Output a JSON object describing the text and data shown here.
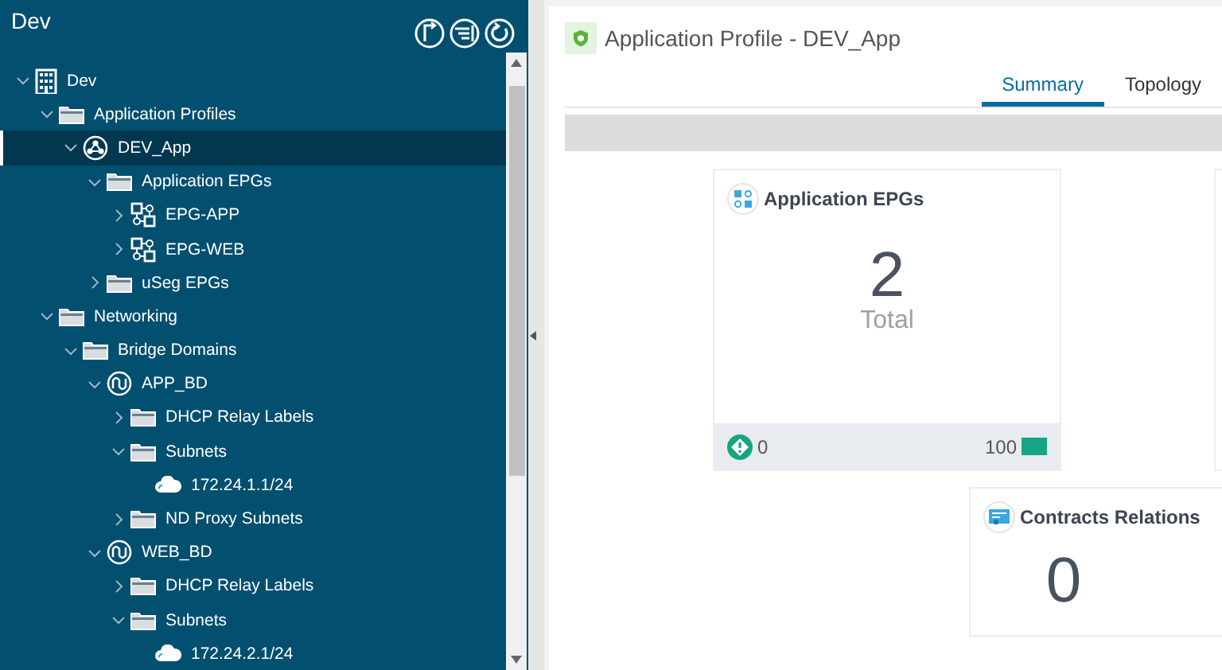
{
  "sidebar": {
    "title": "Dev",
    "toolbar": [
      {
        "kind": "flag"
      },
      {
        "kind": "filter"
      },
      {
        "kind": "refresh"
      }
    ],
    "tree": [
      {
        "label": "Dev",
        "kind": "tenant",
        "expanded": true,
        "selected": false,
        "children": [
          {
            "label": "Application Profiles",
            "kind": "folder",
            "expanded": true,
            "selected": false,
            "children": [
              {
                "label": "DEV_App",
                "kind": "app",
                "expanded": true,
                "selected": true,
                "children": [
                  {
                    "label": "Application EPGs",
                    "kind": "folder",
                    "expanded": true,
                    "selected": false,
                    "children": [
                      {
                        "label": "EPG-APP",
                        "kind": "epg",
                        "expanded": false,
                        "selected": false
                      },
                      {
                        "label": "EPG-WEB",
                        "kind": "epg",
                        "expanded": false,
                        "selected": false
                      }
                    ]
                  },
                  {
                    "label": "uSeg EPGs",
                    "kind": "folder",
                    "expanded": false,
                    "selected": false
                  }
                ]
              }
            ]
          },
          {
            "label": "Networking",
            "kind": "folder",
            "expanded": true,
            "selected": false,
            "children": [
              {
                "label": "Bridge Domains",
                "kind": "folder",
                "expanded": true,
                "selected": false,
                "children": [
                  {
                    "label": "APP_BD",
                    "kind": "bd",
                    "expanded": true,
                    "selected": false,
                    "children": [
                      {
                        "label": "DHCP Relay Labels",
                        "kind": "folder",
                        "expanded": false,
                        "selected": false
                      },
                      {
                        "label": "Subnets",
                        "kind": "folder",
                        "expanded": true,
                        "selected": false,
                        "children": [
                          {
                            "label": "172.24.1.1/24",
                            "kind": "cloud",
                            "selected": false
                          }
                        ]
                      },
                      {
                        "label": "ND Proxy Subnets",
                        "kind": "folder",
                        "expanded": false,
                        "selected": false
                      }
                    ]
                  },
                  {
                    "label": "WEB_BD",
                    "kind": "bd",
                    "expanded": true,
                    "selected": false,
                    "children": [
                      {
                        "label": "DHCP Relay Labels",
                        "kind": "folder",
                        "expanded": false,
                        "selected": false
                      },
                      {
                        "label": "Subnets",
                        "kind": "folder",
                        "expanded": true,
                        "selected": false,
                        "children": [
                          {
                            "label": "172.24.2.1/24",
                            "kind": "cloud",
                            "selected": false
                          }
                        ]
                      }
                    ]
                  }
                ]
              }
            ]
          }
        ]
      }
    ]
  },
  "main": {
    "title": "Application Profile - DEV_App",
    "tabs": [
      {
        "label": "Summary",
        "selected": true
      },
      {
        "label": "Topology",
        "selected": false
      }
    ],
    "cards": [
      {
        "kind": "epgs",
        "title": "Application EPGs",
        "value": "2",
        "caption": "Total",
        "faults": "0",
        "health": "100"
      },
      {
        "kind": "blank"
      },
      {
        "kind": "contracts",
        "title": "Contracts Relations",
        "value": "0"
      }
    ]
  }
}
